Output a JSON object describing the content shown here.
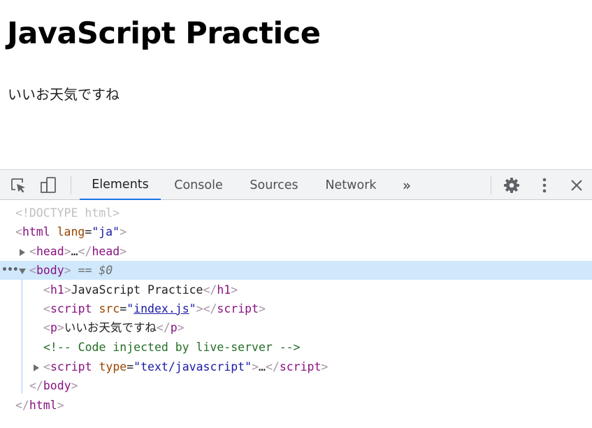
{
  "page": {
    "heading": "JavaScript Practice",
    "paragraph": "いいお天気ですね"
  },
  "devtools": {
    "tabs": [
      "Elements",
      "Console",
      "Sources",
      "Network"
    ],
    "active_tab": "Elements",
    "more_tabs_label": "»",
    "icons": {
      "inspect": "inspect-element-icon",
      "device": "device-toolbar-icon",
      "settings": "gear-icon",
      "menu": "vertical-dots-icon",
      "close": "close-icon"
    },
    "accent_color": "#1a73e8",
    "selection_color": "#cfe8fc"
  },
  "tree": {
    "doctype": "<!DOCTYPE html>",
    "html_tag": "html",
    "lang_attr": "lang",
    "lang_value": "ja",
    "head_tag": "head",
    "ellipsis": "…",
    "selection_dots": "•••",
    "body_tag": "body",
    "selected_suffix": "== $0",
    "h1_tag": "h1",
    "h1_text": "JavaScript Practice",
    "script_tag": "script",
    "src_attr": "src",
    "src_value": "index.js",
    "p_tag": "p",
    "p_text": "いいお天気ですね",
    "comment": "<!-- Code injected by live-server -->",
    "type_attr": "type",
    "type_value": "text/javascript"
  }
}
